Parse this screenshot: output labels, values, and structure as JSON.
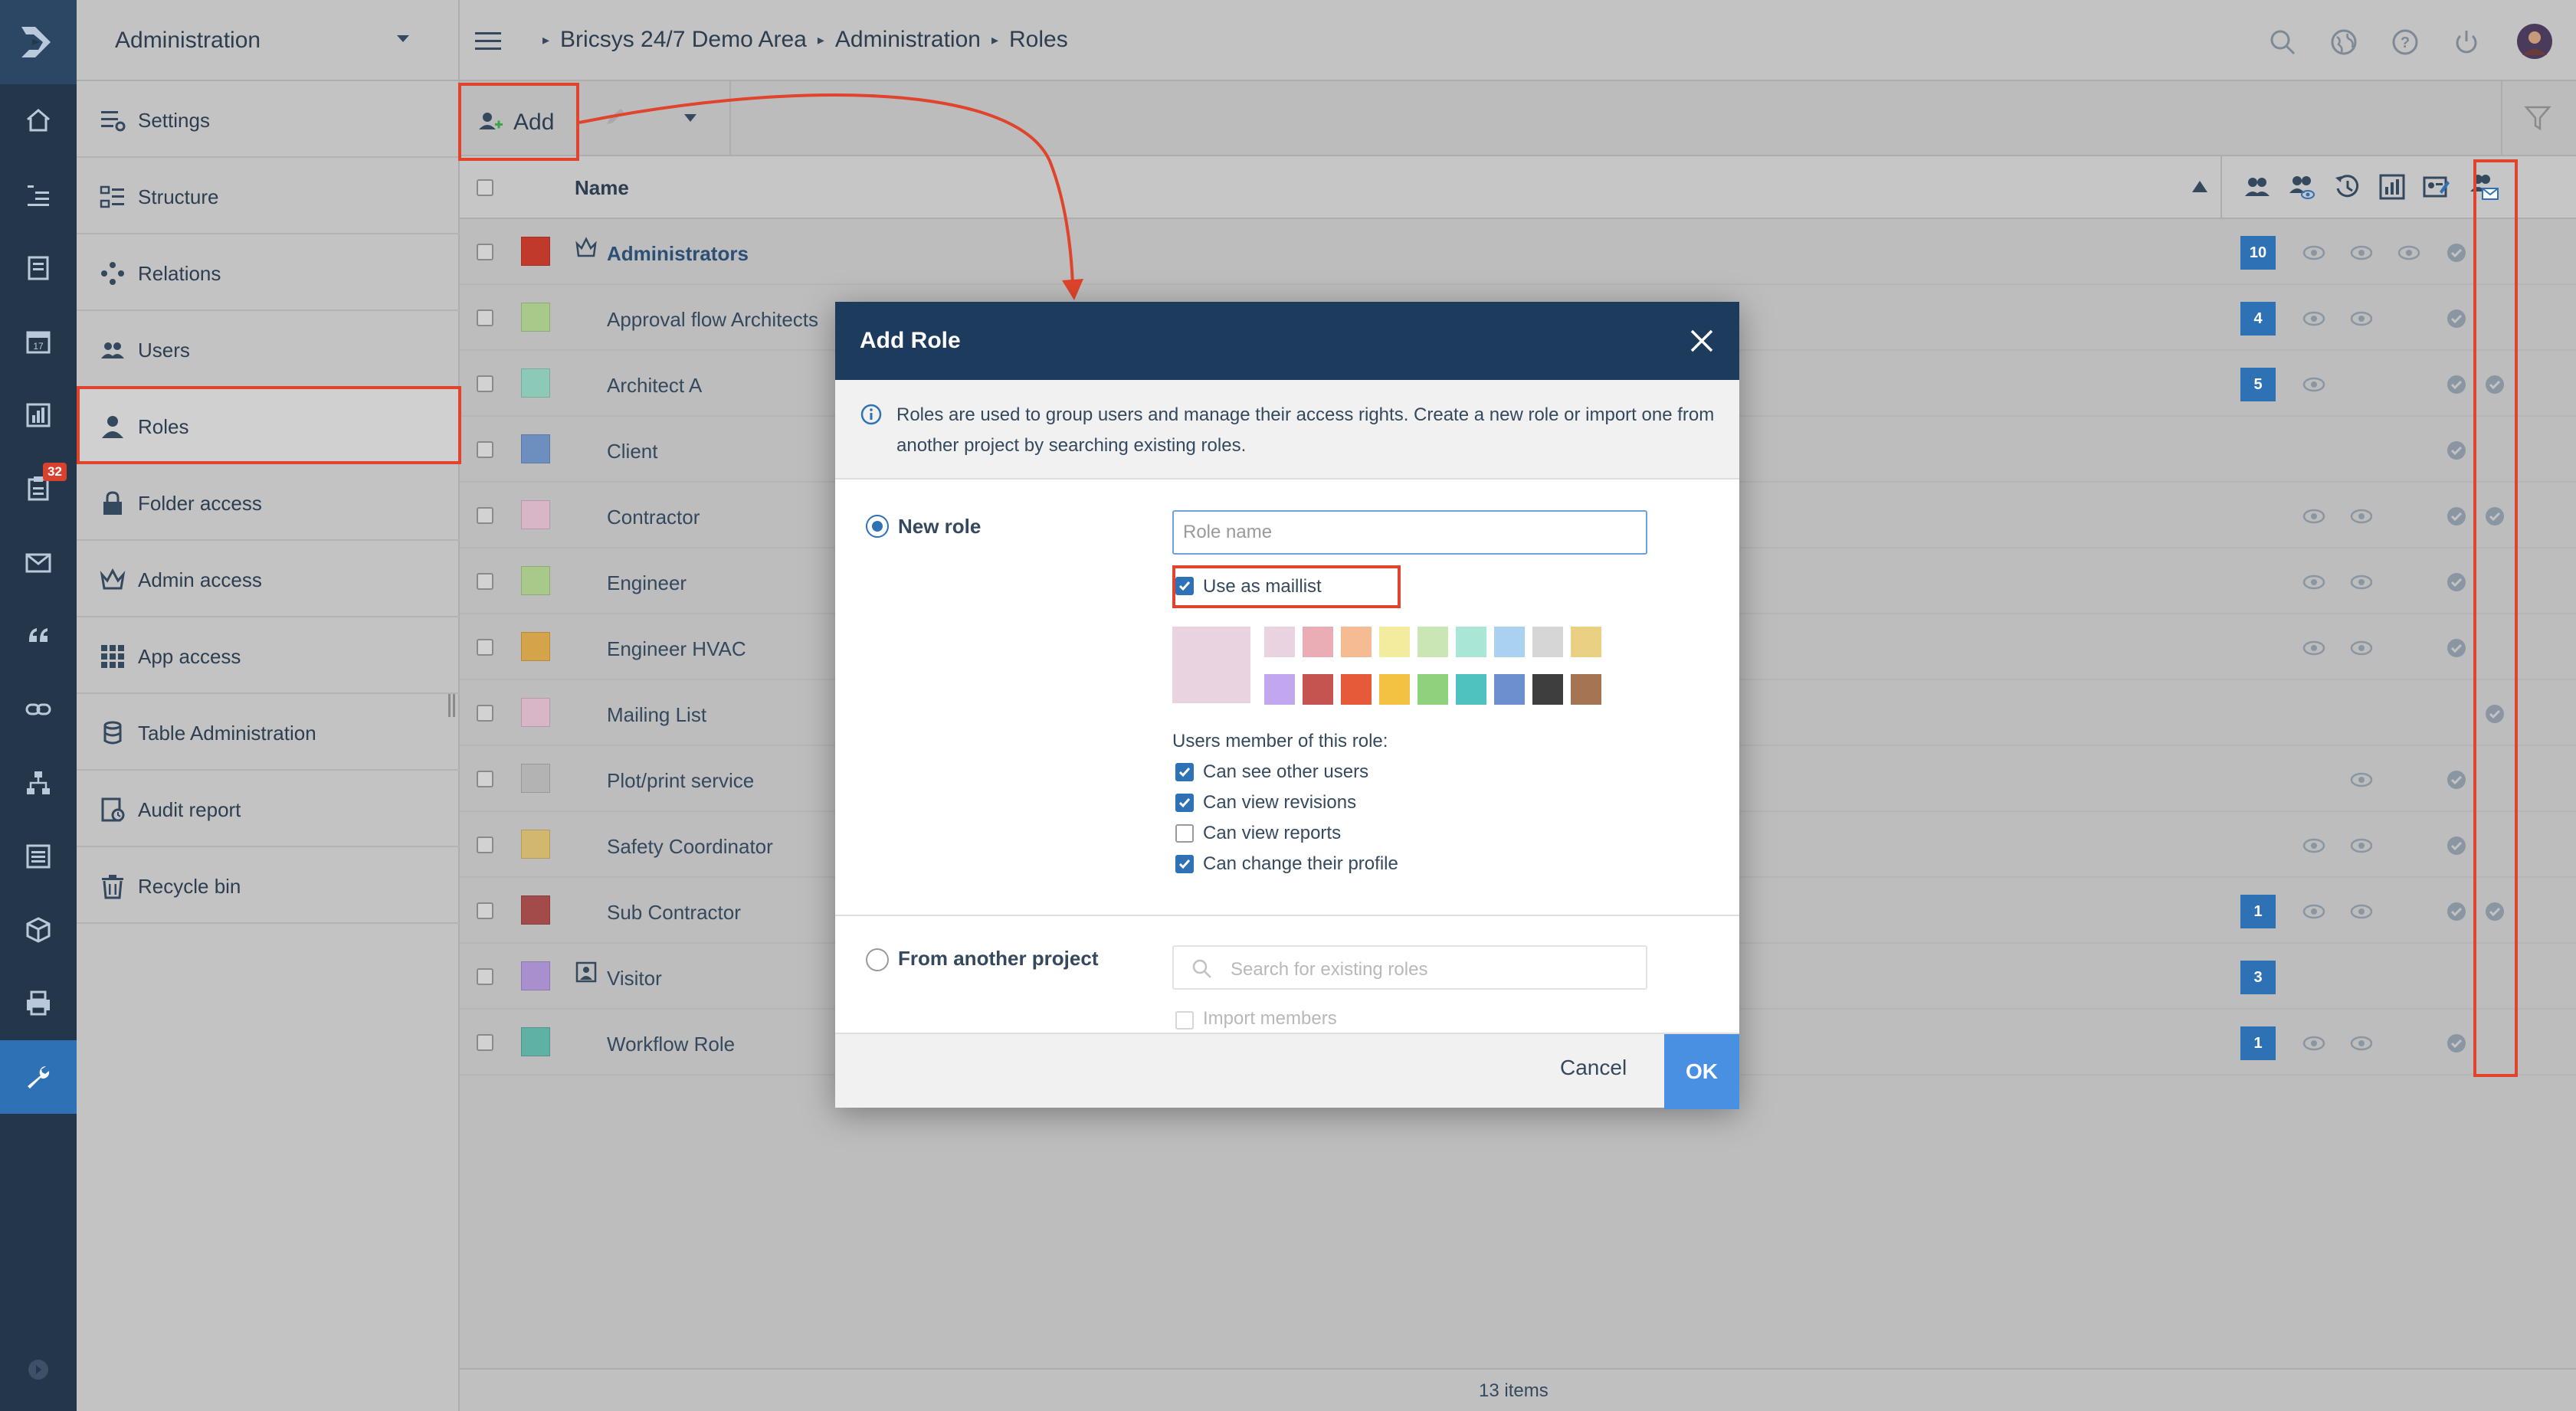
{
  "rail": {
    "items": [
      "home-icon",
      "tree-icon",
      "document-icon",
      "calendar-icon",
      "chart-icon",
      "clipboard-icon",
      "mail-icon",
      "quote-icon",
      "link-icon",
      "hierarchy-icon",
      "list-icon",
      "cube-icon",
      "printer-icon",
      "wrench-icon"
    ],
    "badge": "32"
  },
  "sidebar": {
    "title": "Administration",
    "items": [
      {
        "label": "Settings",
        "icon": "settings-icon"
      },
      {
        "label": "Structure",
        "icon": "structure-icon"
      },
      {
        "label": "Relations",
        "icon": "relations-icon"
      },
      {
        "label": "Users",
        "icon": "users-icon"
      },
      {
        "label": "Roles",
        "icon": "role-icon"
      },
      {
        "label": "Folder access",
        "icon": "lock-icon"
      },
      {
        "label": "Admin access",
        "icon": "crown-icon"
      },
      {
        "label": "App access",
        "icon": "grid-icon"
      },
      {
        "label": "Table Administration",
        "icon": "database-icon"
      },
      {
        "label": "Audit report",
        "icon": "audit-icon"
      },
      {
        "label": "Recycle bin",
        "icon": "trash-icon"
      }
    ]
  },
  "breadcrumb": [
    "Bricsys 24/7 Demo Area",
    "Administration",
    "Roles"
  ],
  "toolbar": {
    "add_label": "Add"
  },
  "table": {
    "name_header": "Name",
    "rows": [
      {
        "name": "Administrators",
        "color": "#c0392b",
        "bold": true,
        "icon": "crown",
        "count": "10",
        "eyes": [
          true,
          true,
          true
        ],
        "check": true,
        "mail": false
      },
      {
        "name": "Approval flow Architects",
        "color": "#a8c98a",
        "count": "4",
        "eyes": [
          true,
          true,
          false
        ],
        "check": true,
        "mail": false
      },
      {
        "name": "Architect A",
        "color": "#8dc9b8",
        "count": "5",
        "eyes": [
          true,
          false,
          false
        ],
        "check": true,
        "mail": true
      },
      {
        "name": "Client",
        "color": "#6c8fc0",
        "count": "",
        "eyes": [
          false,
          false,
          false
        ],
        "check": true,
        "mail": false
      },
      {
        "name": "Contractor",
        "color": "#d8b6c8",
        "count": "",
        "eyes": [
          true,
          true,
          false
        ],
        "check": true,
        "mail": true
      },
      {
        "name": "Engineer",
        "color": "#a8c98a",
        "count": "",
        "eyes": [
          true,
          true,
          false
        ],
        "check": true,
        "mail": false
      },
      {
        "name": "Engineer HVAC",
        "color": "#d4a44a",
        "count": "",
        "eyes": [
          true,
          true,
          false
        ],
        "check": true,
        "mail": false
      },
      {
        "name": "Mailing List",
        "color": "#d8b6c8",
        "count": "",
        "eyes": [
          false,
          false,
          false
        ],
        "check": false,
        "mail": true
      },
      {
        "name": "Plot/print service",
        "color": "#b3b3b3",
        "count": "",
        "eyes": [
          false,
          true,
          false
        ],
        "check": true,
        "mail": false
      },
      {
        "name": "Safety Coordinator",
        "color": "#d2b86e",
        "count": "",
        "eyes": [
          true,
          true,
          false
        ],
        "check": true,
        "mail": false
      },
      {
        "name": "Sub Contractor",
        "color": "#a34b4b",
        "count": "1",
        "eyes": [
          true,
          true,
          false
        ],
        "check": true,
        "mail": true
      },
      {
        "name": "Visitor",
        "color": "#a98fce",
        "icon": "visitor",
        "count": "3",
        "eyes": [
          false,
          false,
          false
        ],
        "check": false,
        "mail": false
      },
      {
        "name": "Workflow Role",
        "color": "#5fb0a5",
        "count": "1",
        "eyes": [
          true,
          true,
          false
        ],
        "check": true,
        "mail": false
      }
    ],
    "footer": "13 items"
  },
  "modal": {
    "title": "Add Role",
    "info": "Roles are used to group users and manage their access rights. Create a new role or import one from another project by searching existing roles.",
    "new_role_label": "New role",
    "role_name_placeholder": "Role name",
    "use_as_maillist_label": "Use as maillist",
    "selected_color": "#ead3e0",
    "colors_row1": [
      "#ead3e0",
      "#eaadb5",
      "#f5bb93",
      "#f3ec9e",
      "#c9e6b4",
      "#aae6d5",
      "#a9d2f0",
      "#d6d6d6",
      "#ead082"
    ],
    "colors_row2": [
      "#c3a7ee",
      "#c5534f",
      "#e65a3a",
      "#f3c242",
      "#8fd17d",
      "#4fc2c0",
      "#6b8fcf",
      "#3e3e3e",
      "#a57553"
    ],
    "members_heading": "Users member of this role:",
    "permissions": [
      {
        "label": "Can see other users",
        "checked": true
      },
      {
        "label": "Can view revisions",
        "checked": true
      },
      {
        "label": "Can view reports",
        "checked": false
      },
      {
        "label": "Can change their profile",
        "checked": true
      }
    ],
    "from_project_label": "From another project",
    "search_placeholder": "Search for existing roles",
    "import_members_label": "Import members",
    "cancel_label": "Cancel",
    "ok_label": "OK"
  },
  "colors": {
    "accent": "#2f71b5",
    "header": "#1d3b5c",
    "annotation": "#e0442c"
  }
}
